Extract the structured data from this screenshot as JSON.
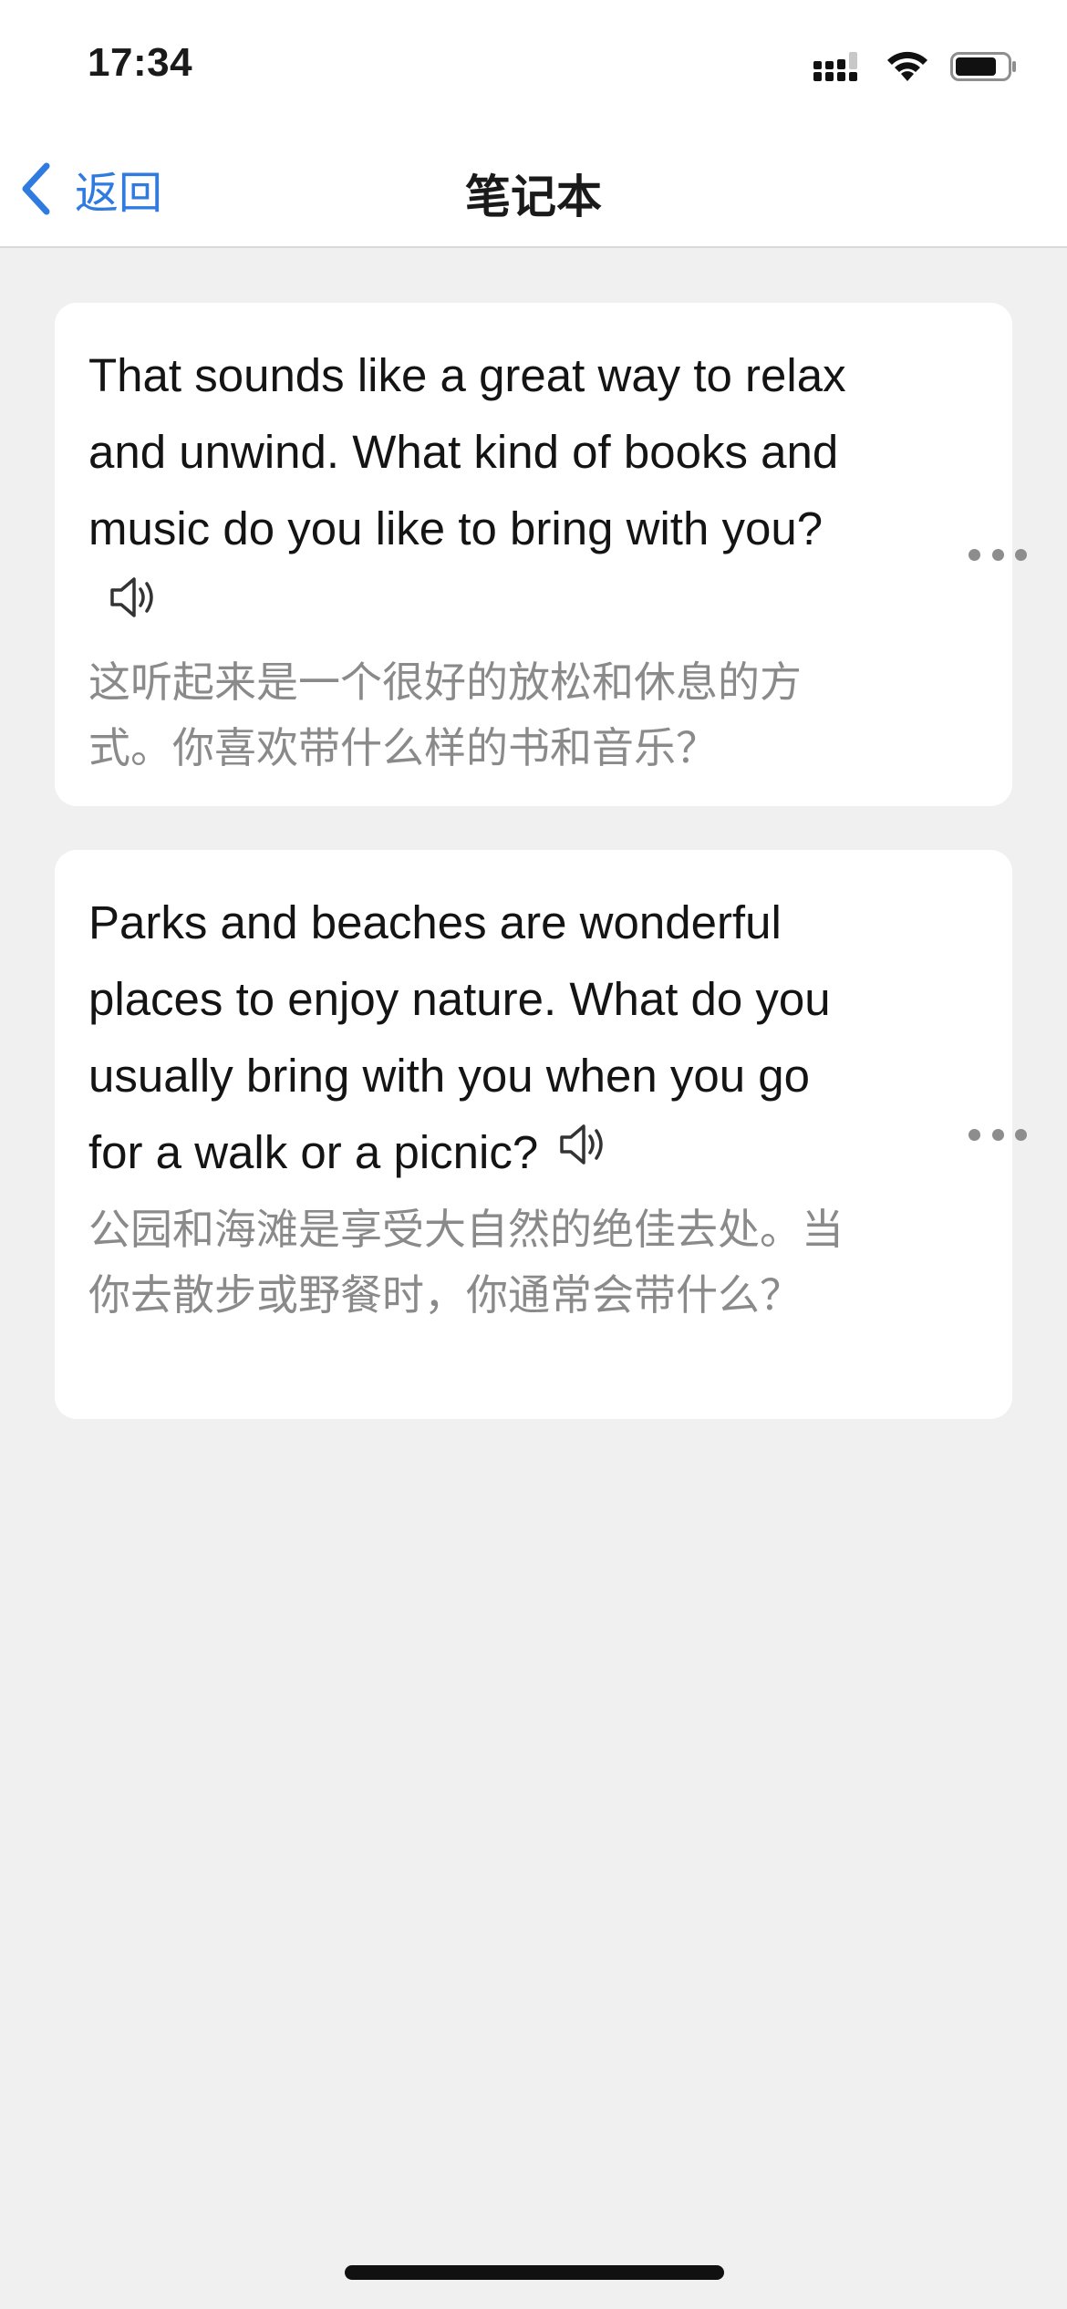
{
  "status_bar": {
    "time": "17:34",
    "icons": [
      "cellular-signal-icon",
      "wifi-icon",
      "battery-icon"
    ],
    "battery_level": 0.75
  },
  "nav": {
    "back_label": "返回",
    "back_icon": "chevron-left-icon",
    "title": "笔记本",
    "accent_color": "#2f7be0"
  },
  "notes": [
    {
      "english": "That sounds like a great way to relax and unwind. What kind of books and music do you like to bring with you?",
      "chinese": "这听起来是一个很好的放松和休息的方式。你喜欢带什么样的书和音乐？",
      "speaker_icon": "speaker-icon",
      "more_icon": "more-dots-icon"
    },
    {
      "english": "Parks and beaches are wonderful places to enjoy nature. What do you usually bring with you when you go for a walk or a picnic?",
      "chinese": "公园和海滩是享受大自然的绝佳去处。当你去散步或野餐时，你通常会带什么？",
      "speaker_icon": "speaker-icon",
      "more_icon": "more-dots-icon"
    }
  ]
}
